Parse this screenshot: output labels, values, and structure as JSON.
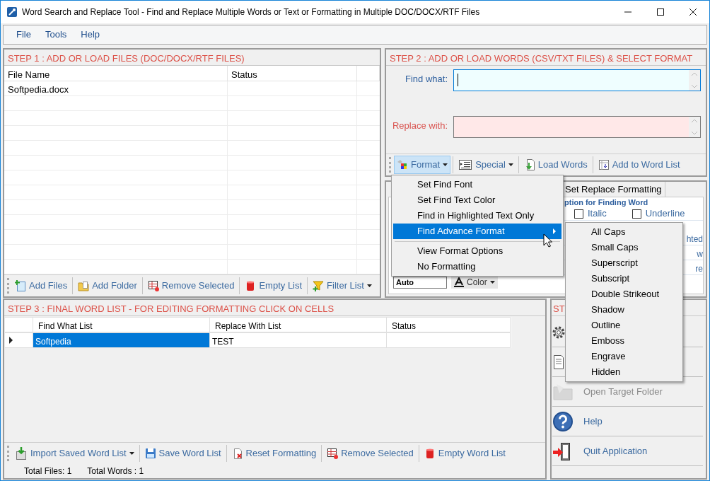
{
  "window": {
    "title": "Word Search and Replace Tool - Find and Replace Multiple Words or Text  or Formatting in Multiple DOC/DOCX/RTF Files"
  },
  "menu_bar": [
    {
      "label": "File"
    },
    {
      "label": "Tools"
    },
    {
      "label": "Help"
    }
  ],
  "step1": {
    "title": "STEP 1 : ADD OR LOAD FILES (DOC/DOCX/RTF FILES)",
    "columns": [
      "File Name",
      "Status"
    ],
    "rows": [
      {
        "file_name": "Softpedia.docx"
      }
    ],
    "toolbar": [
      {
        "label": "Add Files",
        "dropdown": false
      },
      {
        "label": "Add Folder",
        "dropdown": false
      },
      {
        "label": "Remove Selected",
        "dropdown": false
      },
      {
        "label": "Empty List",
        "dropdown": false
      },
      {
        "label": "Filter List",
        "dropdown": true
      }
    ]
  },
  "step2": {
    "title": "STEP 2 : ADD OR LOAD WORDS (CSV/TXT FILES) & SELECT FORMAT",
    "fields": [
      {
        "label": "Find what:",
        "kind": "find",
        "focused": true
      },
      {
        "label": "Replace with:",
        "kind": "replace",
        "focused": false
      }
    ],
    "toolbar": [
      {
        "label": "Format",
        "dropdown": true,
        "open": true
      },
      {
        "label": "Special",
        "dropdown": true,
        "open": false
      },
      {
        "label": "Load Words",
        "dropdown": false,
        "open": false
      },
      {
        "label": "Add to Word List",
        "dropdown": false,
        "open": false
      }
    ]
  },
  "format_panel": {
    "tabs": [
      {
        "label": "Set Replace Formatting",
        "selected": false
      }
    ],
    "group_title": "ption for Finding Word",
    "options": [
      {
        "label": "Italic",
        "checked": false
      },
      {
        "label": "Underline",
        "checked": false
      }
    ],
    "cut_texts": [
      "hted",
      "w",
      "re"
    ],
    "size_select": {
      "value": "Auto"
    },
    "color_button": {
      "label": "Color",
      "dropdown": true
    }
  },
  "step3": {
    "title": "STEP 3 : FINAL WORD LIST - FOR EDITING FORMATTING CLICK ON CELLS",
    "columns": [
      "Find What List",
      "Replace With List",
      "Status"
    ],
    "rows": [
      {
        "find": "Softpedia",
        "replace": "TEST",
        "selected": true
      }
    ],
    "toolbar": [
      {
        "label": "Import Saved Word List",
        "dropdown": true
      },
      {
        "label": "Save Word List",
        "dropdown": false
      },
      {
        "label": "Reset Formatting",
        "dropdown": false
      },
      {
        "label": "Remove Selected",
        "dropdown": false
      },
      {
        "label": "Empty Word List",
        "dropdown": false
      }
    ],
    "status": [
      "Total Files: 1",
      "Total Words : 1"
    ]
  },
  "step4": {
    "title": "ST",
    "actions": [
      {
        "disabled": false
      },
      {
        "disabled": false
      },
      {
        "label": "Open Target Folder",
        "disabled": true
      },
      {
        "label": "Help",
        "disabled": false
      },
      {
        "label": "Quit Application",
        "disabled": false
      }
    ]
  },
  "format_menu": {
    "items": [
      {
        "label": "Set Find Font",
        "kind": "item",
        "selected": false
      },
      {
        "label": "Set Find Text Color",
        "kind": "item",
        "selected": false
      },
      {
        "label": "Find in Highlighted Text Only",
        "kind": "item",
        "selected": false
      },
      {
        "label": "Find Advance Format",
        "kind": "submenu",
        "selected": true
      },
      {
        "kind": "separator"
      },
      {
        "label": "View Format Options",
        "kind": "item",
        "selected": false
      },
      {
        "label": "No Formatting",
        "kind": "item",
        "selected": false
      }
    ]
  },
  "advance_submenu": {
    "items": [
      {
        "label": "All Caps"
      },
      {
        "label": "Small Caps"
      },
      {
        "label": "Superscript"
      },
      {
        "label": "Subscript"
      },
      {
        "label": "Double Strikeout"
      },
      {
        "label": "Shadow"
      },
      {
        "label": "Outline"
      },
      {
        "label": "Emboss"
      },
      {
        "label": "Engrave"
      },
      {
        "label": "Hidden"
      }
    ]
  }
}
